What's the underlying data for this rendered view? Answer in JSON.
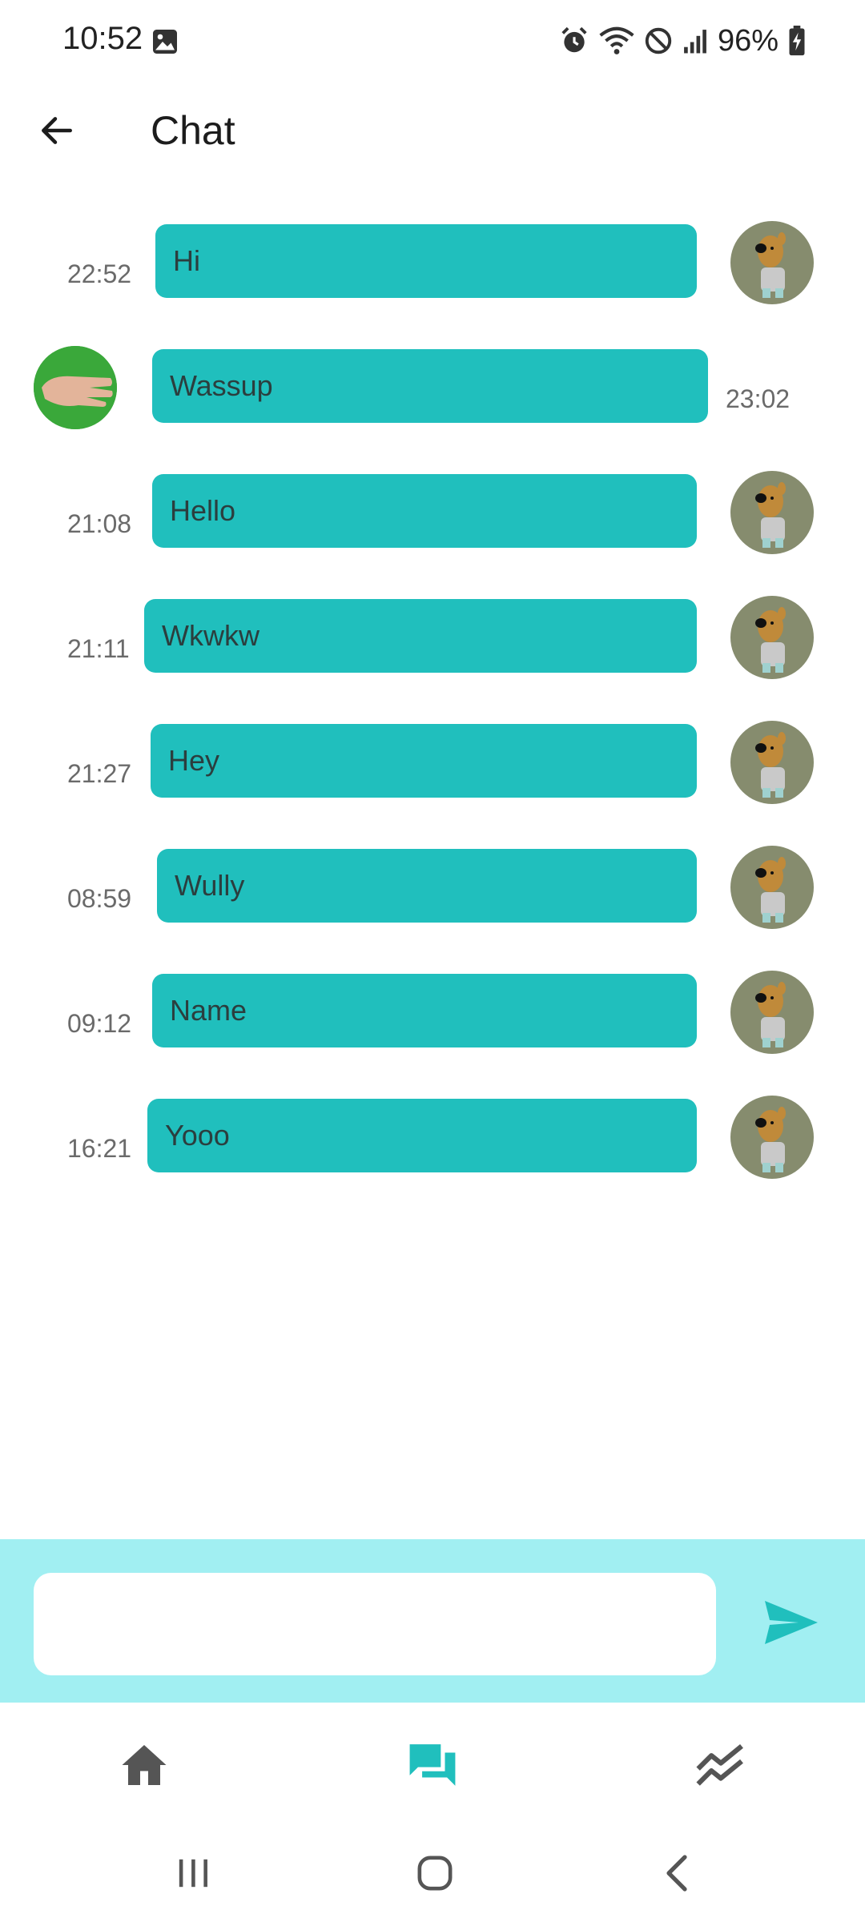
{
  "status_bar": {
    "time": "10:52",
    "battery": "96%",
    "icons": [
      "gallery-icon",
      "alarm-icon",
      "wifi-icon",
      "do-not-disturb-icon",
      "signal-icon",
      "battery-charging-icon"
    ]
  },
  "app_bar": {
    "title": "Chat",
    "back_icon": "arrow-back-icon"
  },
  "messages": [
    {
      "text": "Hi",
      "time": "22:52",
      "sender": "self",
      "avatar": "dog-avatar"
    },
    {
      "text": "Wassup",
      "time": "23:02",
      "sender": "other",
      "avatar": "hand-avatar"
    },
    {
      "text": "Hello",
      "time": "21:08",
      "sender": "self",
      "avatar": "dog-avatar"
    },
    {
      "text": "Wkwkw",
      "time": "21:11",
      "sender": "self",
      "avatar": "dog-avatar"
    },
    {
      "text": "Hey",
      "time": "21:27",
      "sender": "self",
      "avatar": "dog-avatar"
    },
    {
      "text": "Wully",
      "time": "08:59",
      "sender": "self",
      "avatar": "dog-avatar"
    },
    {
      "text": "Name",
      "time": "09:12",
      "sender": "self",
      "avatar": "dog-avatar"
    },
    {
      "text": "Yooo",
      "time": "16:21",
      "sender": "self",
      "avatar": "dog-avatar"
    }
  ],
  "composer": {
    "value": "",
    "placeholder": "",
    "send_icon": "send-icon"
  },
  "bottom_nav": {
    "items": [
      {
        "icon": "home-icon",
        "active": false
      },
      {
        "icon": "chat-icon",
        "active": true
      },
      {
        "icon": "trending-icon",
        "active": false
      }
    ]
  },
  "colors": {
    "bubble": "#20bfbd",
    "composer_bg": "#a1eff2",
    "accent": "#20bfbd",
    "nav_inactive": "#555555"
  }
}
